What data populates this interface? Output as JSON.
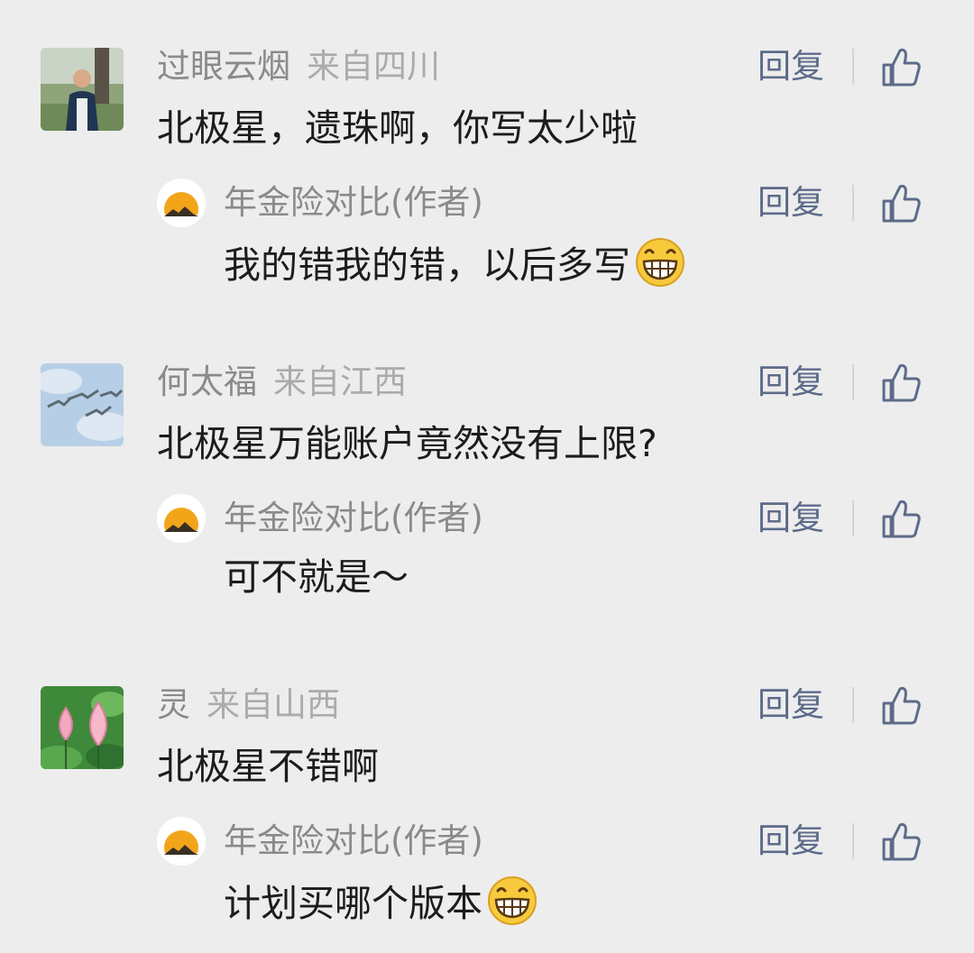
{
  "comments": [
    {
      "user": "过眼云烟",
      "location": "来自四川",
      "text": "北极星，遗珠啊，你写太少啦",
      "avatar_icon": "person-photo-avatar",
      "reply_label": "回复",
      "author_reply": {
        "author": "年金险对比(作者)",
        "text": "我的错我的错，以后多写",
        "emoji": "grin-emoji",
        "reply_label": "回复"
      }
    },
    {
      "user": "何太福",
      "location": "来自江西",
      "text": "北极星万能账户竟然没有上限?",
      "avatar_icon": "birds-sky-avatar",
      "reply_label": "回复",
      "author_reply": {
        "author": "年金险对比(作者)",
        "text": "可不就是～",
        "reply_label": "回复"
      }
    },
    {
      "user": "灵",
      "location": "来自山西",
      "text": "北极星不错啊",
      "avatar_icon": "lotus-avatar",
      "reply_label": "回复",
      "author_reply": {
        "author": "年金险对比(作者)",
        "text": "计划买哪个版本",
        "emoji": "grin-emoji",
        "reply_label": "回复"
      }
    }
  ],
  "colors": {
    "background": "#ededed",
    "name": "#8a8a8a",
    "location": "#ababab",
    "body": "#1c1c1c",
    "action": "#5d6b8a"
  },
  "icons": {
    "like": "thumbs-up-icon",
    "author_avatar": "sunrise-mountain-avatar"
  }
}
